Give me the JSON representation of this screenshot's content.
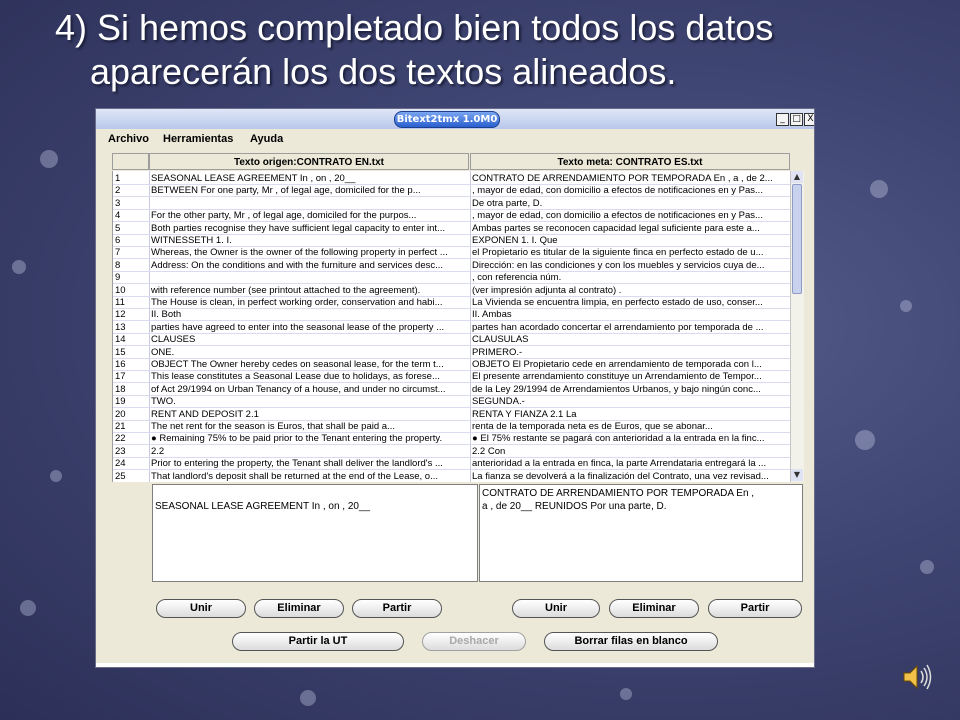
{
  "slide": {
    "title_line1": "4) Si hemos completado bien todos los datos",
    "title_line2": "aparecerán los dos textos alineados."
  },
  "window": {
    "title": "Bitext2tmx 1.0M0",
    "controls": [
      "_",
      "□",
      "X"
    ]
  },
  "menu": [
    "Archivo",
    "Herramientas",
    "Ayuda"
  ],
  "headers": {
    "source": "Texto origen:CONTRATO EN.txt",
    "target": "Texto meta: CONTRATO ES.txt"
  },
  "rows": [
    {
      "n": "1",
      "src": "SEASONAL LEASE AGREEMENT In , on , 20__",
      "tgt": "CONTRATO DE ARRENDAMIENTO POR TEMPORADA En , a , de 2..."
    },
    {
      "n": "2",
      "src": "BETWEEN For one party, Mr            , of legal age, domiciled for the p...",
      "tgt": ", mayor de edad, con domicilio a efectos de notificaciones en y Pas..."
    },
    {
      "n": "3",
      "src": "",
      "tgt": "De otra parte, D."
    },
    {
      "n": "4",
      "src": "For the other party, Mr            , of legal age, domiciled for the purpos...",
      "tgt": ", mayor de edad, con domicilio a efectos de notificaciones en y Pas..."
    },
    {
      "n": "5",
      "src": "Both parties recognise they have sufficient legal capacity to enter int...",
      "tgt": "Ambas partes se reconocen capacidad legal suficiente  para este a..."
    },
    {
      "n": "6",
      "src": "WITNESSETH 1. I.",
      "tgt": "EXPONEN 1. I. Que"
    },
    {
      "n": "7",
      "src": "Whereas, the Owner is the owner of the following property in perfect ...",
      "tgt": "el Propietario es titular de la siguiente finca en perfecto estado de u..."
    },
    {
      "n": "8",
      "src": "Address: On the conditions and with the furniture and services desc...",
      "tgt": "Dirección: en las condiciones y con los muebles y servicios cuya de..."
    },
    {
      "n": "9",
      "src": "",
      "tgt": ", con referencia núm."
    },
    {
      "n": "10",
      "src": "with reference number        (see printout attached to the agreement).",
      "tgt": "(ver impresión adjunta al contrato) ."
    },
    {
      "n": "11",
      "src": "The House is clean, in perfect working order, conservation and habi...",
      "tgt": "La Vivienda se encuentra limpia, en perfecto estado de uso, conser..."
    },
    {
      "n": "12",
      "src": "II. Both",
      "tgt": "II. Ambas"
    },
    {
      "n": "13",
      "src": "parties have agreed to enter into the seasonal lease of the property ...",
      "tgt": "partes han acordado concertar el arrendamiento por temporada de ..."
    },
    {
      "n": "14",
      "src": "CLAUSES",
      "tgt": "CLAUSULAS"
    },
    {
      "n": "15",
      "src": "ONE.",
      "tgt": "PRIMERO.-"
    },
    {
      "n": "16",
      "src": "OBJECT The Owner hereby cedes on seasonal lease, for the term t...",
      "tgt": "OBJETO El Propietario cede en arrendamiento de temporada con l..."
    },
    {
      "n": "17",
      "src": "This lease constitutes a Seasonal Lease due to holidays, as forese...",
      "tgt": "El presente arrendamiento constituye un Arrendamiento de Tempor..."
    },
    {
      "n": "18",
      "src": "of Act 29/1994 on Urban Tenancy of a house, and under no circumst...",
      "tgt": "de la Ley 29/1994 de Arrendamientos Urbanos, y bajo ningún conc..."
    },
    {
      "n": "19",
      "src": "TWO.",
      "tgt": " SEGUNDA.-"
    },
    {
      "n": "20",
      "src": "RENT AND DEPOSIT 2.1",
      "tgt": "RENTA Y FIANZA 2.1 La"
    },
    {
      "n": "21",
      "src": "The net rent for the season is                Euros, that shall be paid a...",
      "tgt": "renta de la temporada neta es de              Euros, que se abonar..."
    },
    {
      "n": "22",
      "src": "● Remaining 75% to be paid prior to the Tenant entering the property.",
      "tgt": "● El 75% restante se pagará con anterioridad a la entrada en la finc..."
    },
    {
      "n": "23",
      "src": " 2.2",
      "tgt": " 2.2 Con"
    },
    {
      "n": "24",
      "src": "Prior to entering the property, the Tenant shall deliver the landlord's ...",
      "tgt": "anterioridad a la entrada en finca, la parte Arrendataria entregará la ..."
    },
    {
      "n": "25",
      "src": "That landlord's deposit shall be returned at the end of the Lease, o...",
      "tgt": "La fianza se devolverá a la finalización del Contrato, una vez revisad..."
    }
  ],
  "panes": {
    "source_text": "\nSEASONAL LEASE AGREEMENT In , on , 20__",
    "target_text": "CONTRATO DE ARRENDAMIENTO POR TEMPORADA En ,\na , de 20__ REUNIDOS Por una parte, D."
  },
  "buttons": {
    "unir_src": "Unir",
    "eliminar_src": "Eliminar",
    "partir_src": "Partir",
    "unir_tgt": "Unir",
    "eliminar_tgt": "Eliminar",
    "partir_tgt": "Partir",
    "partir_ut": "Partir la UT",
    "deshacer": "Deshacer",
    "borrar": "Borrar filas en blanco"
  },
  "icons": {
    "speaker": "speaker-icon"
  }
}
